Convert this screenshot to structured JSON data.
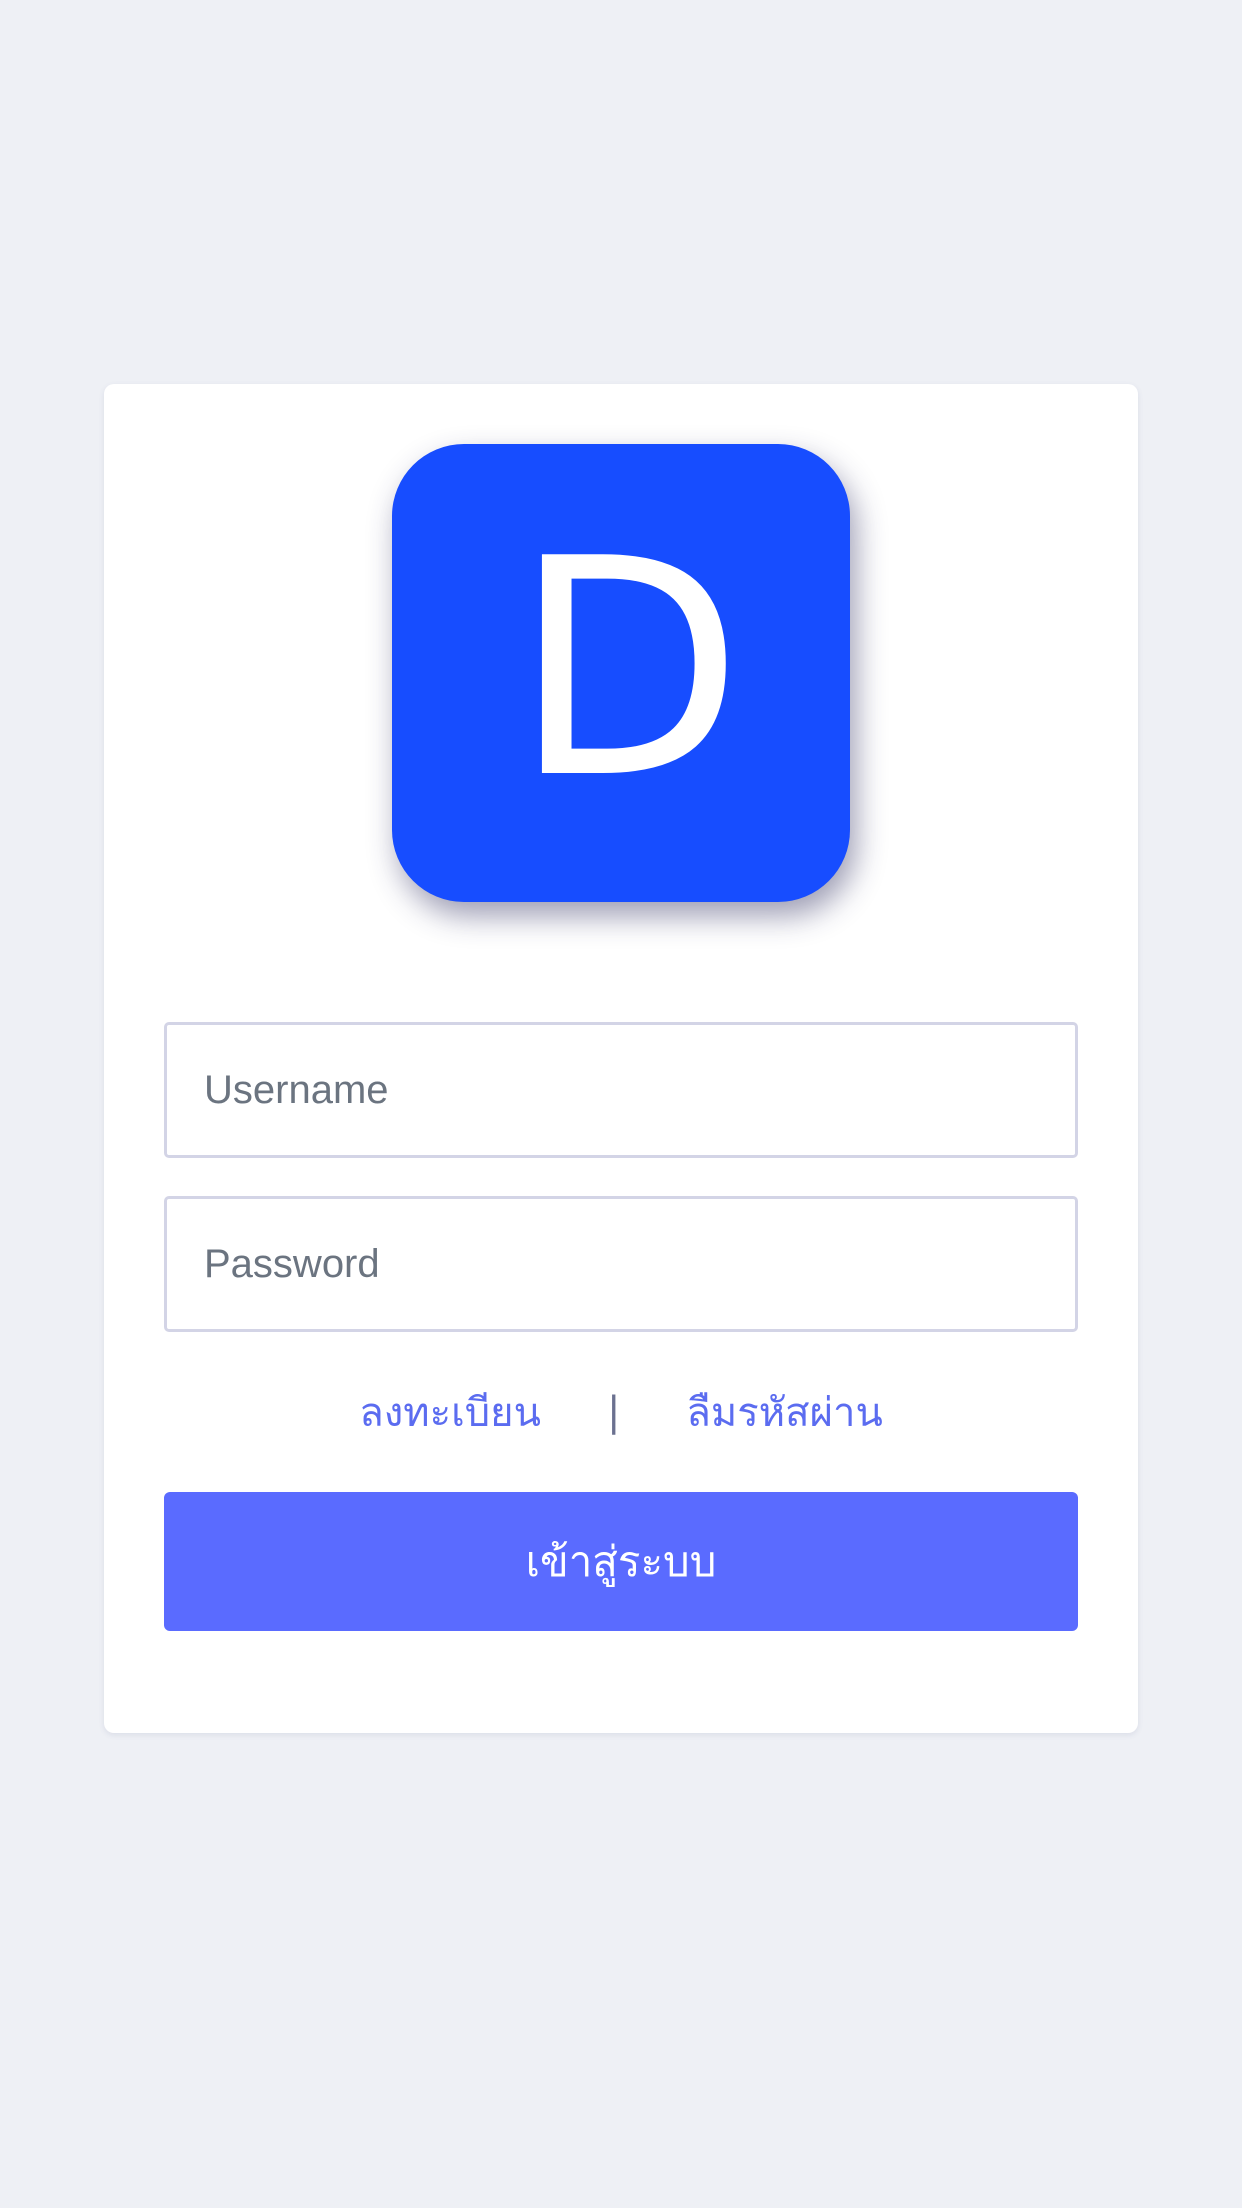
{
  "logo": {
    "letter": "D",
    "background_color": "#174dff"
  },
  "login_form": {
    "username": {
      "placeholder": "Username",
      "value": ""
    },
    "password": {
      "placeholder": "Password",
      "value": ""
    },
    "links": {
      "register_label": "ลงทะเบียน",
      "separator": "|",
      "forgot_password_label": "ลืมรหัสผ่าน"
    },
    "submit_label": "เข้าสู่ระบบ"
  },
  "colors": {
    "page_background": "#eef0f5",
    "card_background": "#ffffff",
    "link": "#5b6cf0",
    "button": "#5a6bff"
  }
}
